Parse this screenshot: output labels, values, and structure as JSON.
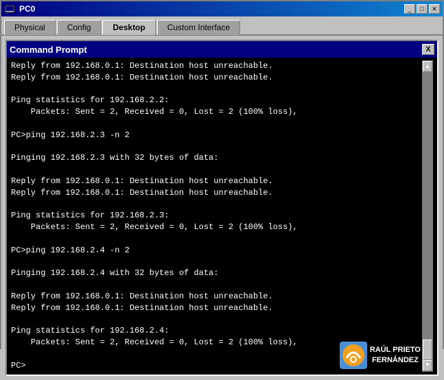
{
  "window": {
    "title": "PC0",
    "icon": "computer-icon"
  },
  "tabs": [
    {
      "id": "physical",
      "label": "Physical",
      "active": false
    },
    {
      "id": "config",
      "label": "Config",
      "active": false
    },
    {
      "id": "desktop",
      "label": "Desktop",
      "active": true
    },
    {
      "id": "custom-interface",
      "label": "Custom Interface",
      "active": false
    }
  ],
  "cmd_window": {
    "title": "Command Prompt",
    "close_label": "X",
    "content": "Reply from 192.168.0.1: Destination host unreachable.\nReply from 192.168.0.1: Destination host unreachable.\n\nPing statistics for 192.168.2.2:\n    Packets: Sent = 2, Received = 0, Lost = 2 (100% loss),\n\nPC>ping 192.168.2.3 -n 2\n\nPinging 192.168.2.3 with 32 bytes of data:\n\nReply from 192.168.0.1: Destination host unreachable.\nReply from 192.168.0.1: Destination host unreachable.\n\nPing statistics for 192.168.2.3:\n    Packets: Sent = 2, Received = 0, Lost = 2 (100% loss),\n\nPC>ping 192.168.2.4 -n 2\n\nPinging 192.168.2.4 with 32 bytes of data:\n\nReply from 192.168.0.1: Destination host unreachable.\nReply from 192.168.0.1: Destination host unreachable.\n\nPing statistics for 192.168.2.4:\n    Packets: Sent = 2, Received = 0, Lost = 2 (100% loss),\n\nPC>"
  },
  "title_buttons": {
    "minimize": "_",
    "maximize": "□",
    "close": "✕"
  },
  "watermark": {
    "name": "RAÚL PRIETO\nFERNÁNDEZ"
  }
}
